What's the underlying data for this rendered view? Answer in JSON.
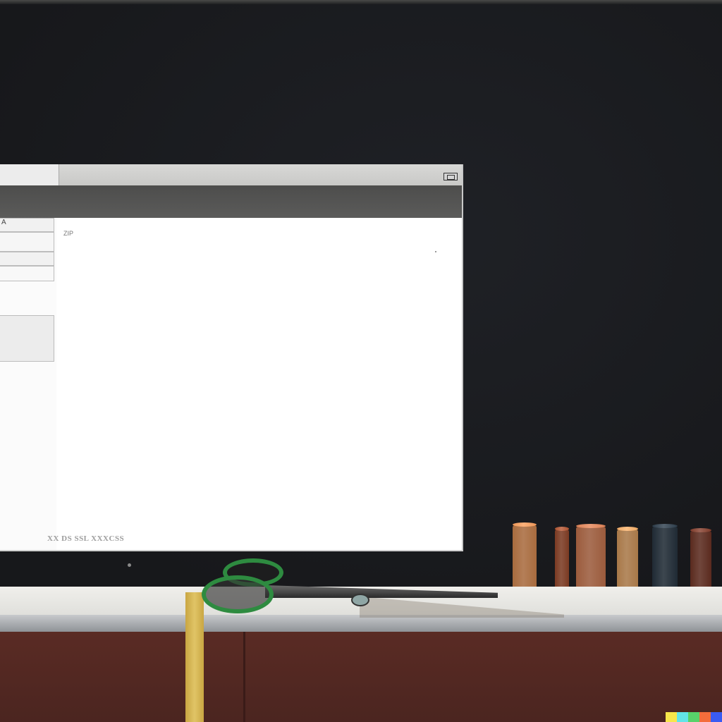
{
  "window": {
    "title": "",
    "status_text": "XX DS SSL XXXCSS"
  },
  "sidebar": {
    "items": [
      {
        "label": "A"
      },
      {
        "label": ""
      },
      {
        "label": ""
      },
      {
        "label": ""
      }
    ]
  },
  "content": {
    "heading": "ZIP",
    "meta": ""
  },
  "scene": {
    "tape_mark": "",
    "spool_colors": [
      "#a86b3e",
      "#7a3a22",
      "#9b5b3c",
      "#a87848",
      "#1f2a34",
      "#5a2a1e"
    ],
    "watermark_colors": [
      "#f7e64b",
      "#62e4e8",
      "#58d26a",
      "#f36d3b",
      "#3a5bf2"
    ]
  }
}
